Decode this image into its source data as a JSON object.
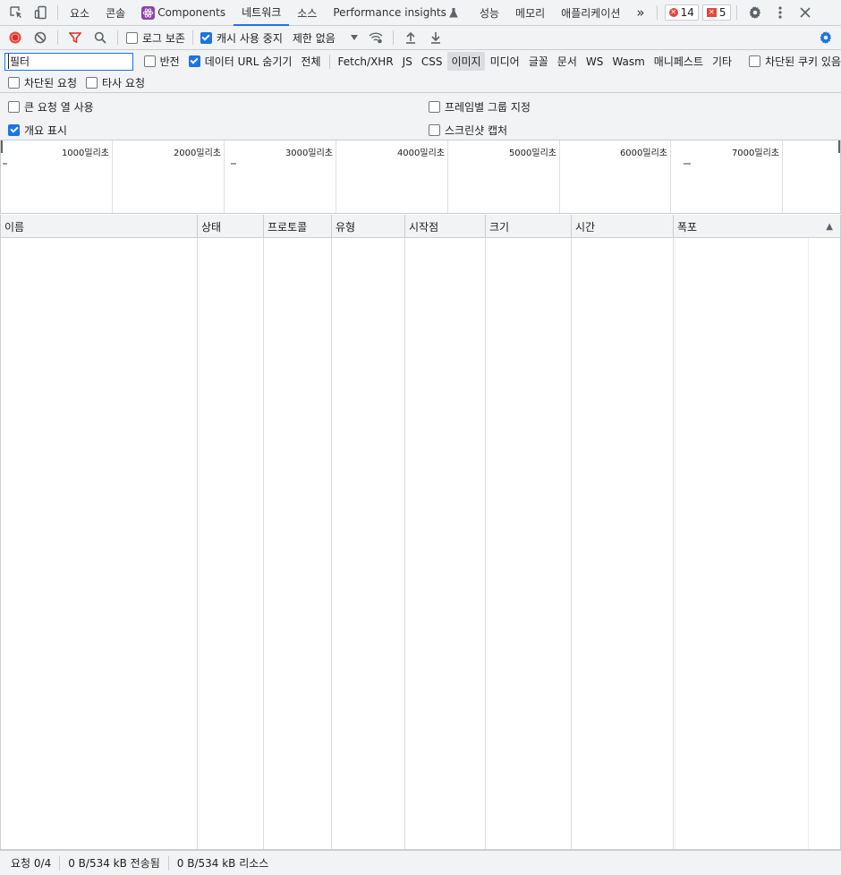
{
  "tabs": {
    "elements": "요소",
    "console": "콘솔",
    "components": "Components",
    "network": "네트워크",
    "sources": "소스",
    "performance_insights": "Performance insights",
    "performance": "성능",
    "memory": "메모리",
    "application": "애플리케이션",
    "more": "»",
    "error_count": "14",
    "issue_count": "5"
  },
  "toolbar": {
    "preserve_log": "로그 보존",
    "disable_cache": "캐시 사용 중지",
    "throttle": "제한 없음"
  },
  "filter": {
    "value": "필터",
    "invert": "반전",
    "hide_data_urls": "데이터 URL 숨기기",
    "types": [
      "전체",
      "Fetch/XHR",
      "JS",
      "CSS",
      "이미지",
      "미디어",
      "글꼴",
      "문서",
      "WS",
      "Wasm",
      "매니페스트",
      "기타"
    ],
    "selected_type": "이미지",
    "blocked_cookies": "차단된 쿠키 있음",
    "blocked_requests": "차단된 요청",
    "third_party": "타사 요청"
  },
  "settings": {
    "big_rows": "큰 요청 열 사용",
    "group_by_frame": "프레임별 그룹 지정",
    "show_overview": "개요 표시",
    "capture_screenshots": "스크린샷 캡처"
  },
  "overview": {
    "ticks": [
      "1000밀리초",
      "2000밀리초",
      "3000밀리초",
      "4000밀리초",
      "5000밀리초",
      "6000밀리초",
      "7000밀리초"
    ]
  },
  "columns": [
    "이름",
    "상태",
    "프로토콜",
    "유형",
    "시작점",
    "크기",
    "시간",
    "폭포"
  ],
  "sort_indicator": "▲",
  "status": {
    "requests": "요청 0/4",
    "transferred": "0 B/534 kB 전송됨",
    "resources": "0 B/534 kB 리소스"
  },
  "colors": {
    "accent": "#1a73e8",
    "record": "#e8453c",
    "filter_icon": "#d93025"
  }
}
